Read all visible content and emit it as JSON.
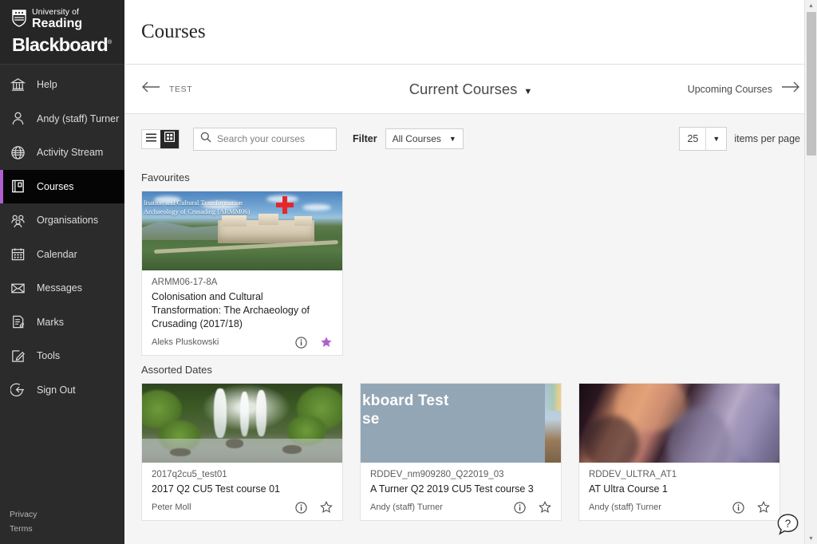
{
  "brand": {
    "university_line1": "University of",
    "university_line2": "Reading",
    "product": "Blackboard",
    "trademark": "®"
  },
  "sidebar": {
    "items": [
      {
        "label": "Help",
        "icon": "bank-icon",
        "active": false
      },
      {
        "label": "Andy (staff) Turner",
        "icon": "person-icon",
        "active": false
      },
      {
        "label": "Activity Stream",
        "icon": "globe-icon",
        "active": false
      },
      {
        "label": "Courses",
        "icon": "book-icon",
        "active": true
      },
      {
        "label": "Organisations",
        "icon": "people-icon",
        "active": false
      },
      {
        "label": "Calendar",
        "icon": "calendar-icon",
        "active": false
      },
      {
        "label": "Messages",
        "icon": "envelope-icon",
        "active": false
      },
      {
        "label": "Marks",
        "icon": "clipboard-icon",
        "active": false
      },
      {
        "label": "Tools",
        "icon": "pencil-square-icon",
        "active": false
      },
      {
        "label": "Sign Out",
        "icon": "sign-out-icon",
        "active": false
      }
    ],
    "footer": {
      "privacy": "Privacy",
      "terms": "Terms"
    },
    "accent_color": "#b05fd0",
    "background_color": "#2b2b2b"
  },
  "header": {
    "title": "Courses"
  },
  "term_bar": {
    "previous_label": "TEST",
    "current_label": "Current Courses",
    "next_label": "Upcoming Courses"
  },
  "toolbar": {
    "view_list_label": "List view",
    "view_grid_label": "Grid view",
    "active_view": "grid",
    "search": {
      "placeholder": "Search your courses",
      "value": ""
    },
    "filter_label": "Filter",
    "filter_value": "All Courses",
    "per_page_value": "25",
    "per_page_label": "items per page"
  },
  "groups": [
    {
      "title": "Favourites",
      "courses": [
        {
          "code": "ARMM06-17-8A",
          "name": "Colonisation and Cultural Transformation: The Archaeology of Crusading (2017/18)",
          "teacher": "Aleks Pluskowski",
          "favourite": true,
          "image_kind": "castle",
          "image_overlay_line1": "lisation and Cultural Transformation",
          "image_overlay_line2": "Archaeology of Crusading (ARMM06)"
        }
      ]
    },
    {
      "title": "Assorted Dates",
      "courses": [
        {
          "code": "2017q2cu5_test01",
          "name": "2017 Q2 CU5 Test course 01",
          "teacher": "Peter Moll",
          "favourite": false,
          "image_kind": "waterfall",
          "image_overlay_line1": "",
          "image_overlay_line2": ""
        },
        {
          "code": "RDDEV_nm909280_Q22019_03",
          "name": "A Turner Q2 2019 CU5 Test course 3",
          "teacher": "Andy (staff) Turner",
          "favourite": false,
          "image_kind": "bbtest",
          "image_overlay_line1": "kboard Test",
          "image_overlay_line2": "se"
        },
        {
          "code": "RDDEV_ULTRA_AT1",
          "name": "AT Ultra Course 1",
          "teacher": "Andy (staff) Turner",
          "favourite": false,
          "image_kind": "canyon",
          "image_overlay_line1": "",
          "image_overlay_line2": ""
        }
      ]
    }
  ],
  "help_widget": {
    "label": "?"
  },
  "colors": {
    "favourite_star": "#b05fd0",
    "page_background": "#f5f5f5",
    "card_background": "#ffffff"
  }
}
